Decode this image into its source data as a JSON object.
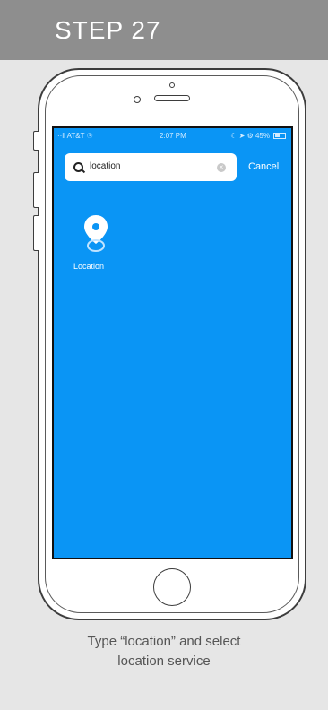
{
  "header": {
    "title": "STEP 27"
  },
  "status_bar": {
    "carrier": "··ll AT&T ☉",
    "time": "2:07 PM",
    "right": "☾ ➤ ⚙ 45%",
    "battery_level": 0.45
  },
  "search": {
    "query": "location",
    "cancel_label": "Cancel"
  },
  "app": {
    "label": "Location",
    "icon": "location-pin-icon"
  },
  "caption": {
    "line1": "Type “location” and select",
    "line2": "location service"
  },
  "colors": {
    "header": "#8e8e8e",
    "screen": "#0a95f5",
    "background": "#e6e6e6"
  }
}
